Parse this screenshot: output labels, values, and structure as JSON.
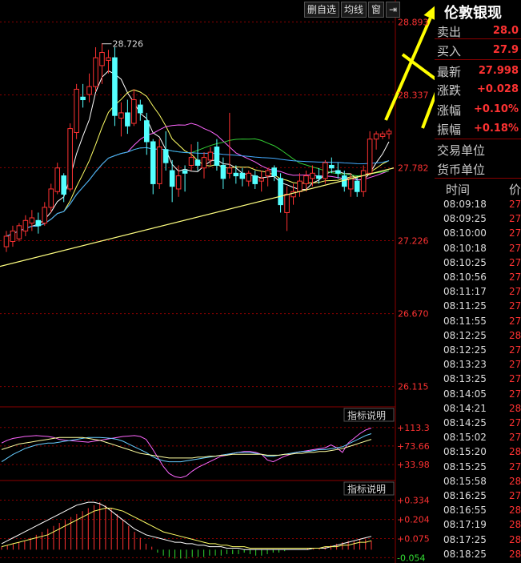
{
  "toolbar": {
    "delete_label": "删自选",
    "ma_label": "均线",
    "window_label": "窗",
    "collapse_label": "⇥"
  },
  "quote": {
    "title": "伦敦银现",
    "rows": [
      {
        "label": "卖出",
        "value": "28.0"
      },
      {
        "label": "买入",
        "value": "27.9"
      },
      {
        "label": "最新",
        "value": "27.998"
      },
      {
        "label": "涨跌",
        "value": "+0.028"
      },
      {
        "label": "涨幅",
        "value": "+0.10%"
      },
      {
        "label": "振幅",
        "value": "+0.18%"
      },
      {
        "label": "交易单位",
        "value": ""
      },
      {
        "label": "货币单位",
        "value": ""
      }
    ],
    "colors": {
      "up": "#ff3232",
      "down": "#54ffff",
      "text": "#cccccc"
    },
    "ticks_header": {
      "time": "时间",
      "price": "价"
    },
    "ticks": [
      {
        "time": "08:09:18",
        "price": "27."
      },
      {
        "time": "08:09:25",
        "price": "27."
      },
      {
        "time": "08:10:00",
        "price": "27."
      },
      {
        "time": "08:10:18",
        "price": "27."
      },
      {
        "time": "08:10:25",
        "price": "27."
      },
      {
        "time": "08:10:56",
        "price": "27."
      },
      {
        "time": "08:11:17",
        "price": "27."
      },
      {
        "time": "08:11:25",
        "price": "27."
      },
      {
        "time": "08:11:55",
        "price": "27."
      },
      {
        "time": "08:12:25",
        "price": "28."
      },
      {
        "time": "08:12:25",
        "price": "27."
      },
      {
        "time": "08:13:23",
        "price": "27."
      },
      {
        "time": "08:13:25",
        "price": "27."
      },
      {
        "time": "08:14:05",
        "price": "27."
      },
      {
        "time": "08:14:21",
        "price": "28."
      },
      {
        "time": "08:14:25",
        "price": "27."
      },
      {
        "time": "08:15:02",
        "price": "27."
      },
      {
        "time": "08:15:20",
        "price": "28."
      },
      {
        "time": "08:15:25",
        "price": "27."
      },
      {
        "time": "08:15:58",
        "price": "28."
      },
      {
        "time": "08:16:25",
        "price": "27."
      },
      {
        "time": "08:16:55",
        "price": "28."
      },
      {
        "time": "08:17:19",
        "price": "28."
      },
      {
        "time": "08:17:25",
        "price": "28."
      },
      {
        "time": "08:18:25",
        "price": "28."
      }
    ]
  },
  "chart_data": [
    {
      "type": "candlestick",
      "axis_labels": [
        "28.893",
        "28.337",
        "27.782",
        "27.226",
        "26.670",
        "26.115"
      ],
      "ylim": [
        25.96,
        28.95
      ],
      "annotation": "28.726",
      "annotation_value": 28.726,
      "colors": {
        "up": "#ff3232",
        "down": "#54ffff",
        "trendline": "#ffff80",
        "arrow": "#ffff00"
      },
      "candles": [
        [
          27.18,
          27.3,
          27.14,
          27.26
        ],
        [
          27.22,
          27.34,
          27.18,
          27.3
        ],
        [
          27.24,
          27.36,
          27.22,
          27.34
        ],
        [
          27.3,
          27.42,
          27.26,
          27.38
        ],
        [
          27.36,
          27.46,
          27.3,
          27.4
        ],
        [
          27.38,
          27.44,
          27.28,
          27.34
        ],
        [
          27.36,
          27.52,
          27.34,
          27.48
        ],
        [
          27.48,
          27.66,
          27.44,
          27.62
        ],
        [
          27.6,
          27.82,
          27.58,
          27.78
        ],
        [
          27.72,
          27.74,
          27.52,
          27.58
        ],
        [
          27.62,
          28.12,
          27.6,
          28.08
        ],
        [
          28.05,
          28.42,
          28.0,
          28.38
        ],
        [
          28.32,
          28.42,
          28.24,
          28.3
        ],
        [
          28.34,
          28.5,
          28.28,
          28.4
        ],
        [
          28.4,
          28.7,
          28.36,
          28.62
        ],
        [
          28.56,
          28.73,
          28.42,
          28.66
        ],
        [
          28.6,
          28.68,
          28.5,
          28.62
        ],
        [
          28.62,
          28.7,
          28.1,
          28.18
        ],
        [
          28.16,
          28.28,
          28.02,
          28.2
        ],
        [
          28.2,
          28.3,
          28.04,
          28.1
        ],
        [
          28.12,
          28.38,
          28.1,
          28.3
        ],
        [
          28.26,
          28.3,
          28.14,
          28.2
        ],
        [
          28.14,
          28.2,
          27.88,
          27.98
        ],
        [
          27.98,
          28.0,
          27.58,
          27.66
        ],
        [
          27.66,
          28.0,
          27.62,
          27.94
        ],
        [
          27.92,
          28.06,
          27.76,
          27.82
        ],
        [
          27.76,
          27.84,
          27.52,
          27.64
        ],
        [
          27.62,
          27.8,
          27.56,
          27.72
        ],
        [
          27.76,
          27.8,
          27.6,
          27.74
        ],
        [
          27.8,
          27.96,
          27.76,
          27.86
        ],
        [
          27.84,
          27.98,
          27.76,
          27.8
        ],
        [
          27.78,
          27.9,
          27.7,
          27.86
        ],
        [
          27.84,
          27.94,
          27.8,
          27.9
        ],
        [
          27.94,
          28.0,
          27.76,
          27.8
        ],
        [
          27.8,
          27.86,
          27.62,
          27.7
        ],
        [
          27.74,
          28.2,
          27.7,
          27.78
        ],
        [
          27.74,
          27.8,
          27.66,
          27.72
        ],
        [
          27.74,
          27.78,
          27.64,
          27.7
        ],
        [
          27.68,
          27.76,
          27.64,
          27.74
        ],
        [
          27.72,
          27.76,
          27.62,
          27.66
        ],
        [
          27.68,
          27.76,
          27.6,
          27.7
        ],
        [
          27.72,
          27.78,
          27.64,
          27.76
        ],
        [
          27.78,
          27.8,
          27.68,
          27.72
        ],
        [
          27.7,
          27.74,
          27.44,
          27.5
        ],
        [
          27.44,
          27.64,
          27.3,
          27.58
        ],
        [
          27.56,
          27.66,
          27.5,
          27.6
        ],
        [
          27.6,
          27.74,
          27.56,
          27.68
        ],
        [
          27.66,
          27.76,
          27.6,
          27.72
        ],
        [
          27.7,
          27.8,
          27.64,
          27.74
        ],
        [
          27.72,
          27.78,
          27.66,
          27.7
        ],
        [
          27.7,
          27.84,
          27.66,
          27.82
        ],
        [
          27.8,
          27.86,
          27.74,
          27.78
        ],
        [
          27.76,
          27.82,
          27.7,
          27.74
        ],
        [
          27.72,
          27.76,
          27.6,
          27.64
        ],
        [
          27.62,
          27.74,
          27.56,
          27.7
        ],
        [
          27.68,
          27.72,
          27.56,
          27.6
        ],
        [
          27.6,
          27.8,
          27.56,
          27.76
        ],
        [
          27.74,
          28.06,
          27.72,
          28.0
        ],
        [
          28.0,
          28.06,
          27.92,
          28.04
        ],
        [
          28.02,
          28.06,
          28.0,
          28.04
        ],
        [
          28.04,
          28.08,
          28.0,
          28.06
        ]
      ]
    },
    {
      "type": "line",
      "name": "indicator_1",
      "header_label": "指标说明",
      "axis_labels": [
        "+113.3",
        "+73.66",
        "+33.98"
      ],
      "axis_values": [
        113.3,
        73.66,
        33.98
      ],
      "ylim": [
        0,
        130
      ],
      "series": [
        {
          "values": [
            80,
            86,
            90,
            92,
            94,
            95,
            96,
            95,
            94,
            92,
            88,
            86,
            85,
            84,
            83,
            82,
            84,
            86,
            88,
            90,
            92,
            94,
            95,
            96,
            94,
            88,
            70,
            50,
            30,
            15,
            8,
            6,
            10,
            20,
            28,
            34,
            40,
            46,
            52,
            54,
            58,
            60,
            62,
            62,
            60,
            56,
            44,
            40,
            46,
            52,
            56,
            60,
            62,
            64,
            66,
            68,
            70,
            76,
            70,
            60,
            80,
            90,
            100,
            108,
            112
          ],
          "color": "#ff66ff"
        },
        {
          "values": [
            40,
            48,
            56,
            62,
            68,
            72,
            76,
            78,
            80,
            80,
            82,
            84,
            86,
            88,
            90,
            92,
            92,
            92,
            91,
            90,
            88,
            84,
            78,
            72,
            66,
            60,
            52,
            46,
            42,
            40,
            40,
            40,
            42,
            44,
            46,
            48,
            50,
            52,
            54,
            56,
            58,
            60,
            60,
            60,
            58,
            56,
            52,
            52,
            54,
            56,
            58,
            60,
            62,
            62,
            64,
            66,
            66,
            68,
            70,
            72,
            78,
            84,
            90,
            96,
            100
          ],
          "color": "#66ccff"
        },
        {
          "values": [
            66,
            70,
            74,
            78,
            80,
            82,
            84,
            86,
            88,
            90,
            92,
            92,
            92,
            92,
            92,
            90,
            88,
            86,
            82,
            78,
            74,
            70,
            66,
            62,
            58,
            56,
            54,
            52,
            50,
            48,
            48,
            48,
            48,
            48,
            50,
            50,
            52,
            52,
            54,
            54,
            56,
            56,
            56,
            56,
            56,
            56,
            54,
            54,
            54,
            56,
            56,
            58,
            58,
            60,
            60,
            62,
            62,
            64,
            66,
            68,
            72,
            76,
            80,
            84,
            88
          ],
          "color": "#ffffa0"
        }
      ]
    },
    {
      "type": "bar+line",
      "name": "indicator_2",
      "header_label": "指标说明",
      "axis_labels": [
        "+0.334",
        "+0.204",
        "+0.075",
        "-0.054"
      ],
      "axis_values": [
        0.334,
        0.204,
        0.075,
        -0.054
      ],
      "ylim": [
        -0.09,
        0.38
      ],
      "bars": [
        0.02,
        0.03,
        0.04,
        0.05,
        0.06,
        0.08,
        0.1,
        0.12,
        0.14,
        0.16,
        0.18,
        0.2,
        0.22,
        0.24,
        0.26,
        0.28,
        0.3,
        0.32,
        0.3,
        0.28,
        0.24,
        0.2,
        0.16,
        0.12,
        0.08,
        0.04,
        0.02,
        -0.02,
        -0.04,
        -0.05,
        -0.06,
        -0.06,
        -0.06,
        -0.05,
        -0.05,
        -0.05,
        -0.04,
        -0.04,
        -0.04,
        -0.03,
        -0.03,
        -0.03,
        -0.02,
        -0.03,
        -0.04,
        -0.04,
        -0.03,
        -0.02,
        -0.02,
        -0.01,
        0.0,
        0.0,
        0.0,
        0.01,
        0.01,
        0.01,
        0.02,
        0.03,
        0.04,
        0.05,
        0.06,
        0.06,
        0.07,
        0.07,
        0.06
      ],
      "series": [
        {
          "values": [
            0.04,
            0.06,
            0.08,
            0.1,
            0.12,
            0.14,
            0.16,
            0.18,
            0.2,
            0.22,
            0.24,
            0.26,
            0.28,
            0.3,
            0.31,
            0.32,
            0.32,
            0.31,
            0.29,
            0.26,
            0.23,
            0.2,
            0.17,
            0.14,
            0.12,
            0.1,
            0.09,
            0.08,
            0.07,
            0.06,
            0.05,
            0.05,
            0.04,
            0.04,
            0.03,
            0.03,
            0.02,
            0.02,
            0.02,
            0.01,
            0.01,
            0.01,
            0.0,
            0.0,
            0.0,
            0.0,
            0.0,
            0.0,
            0.0,
            0.0,
            0.0,
            0.0,
            0.0,
            0.0,
            0.01,
            0.01,
            0.01,
            0.02,
            0.03,
            0.04,
            0.05,
            0.06,
            0.07,
            0.08,
            0.09
          ],
          "color": "#ffffff"
        },
        {
          "values": [
            0.02,
            0.03,
            0.04,
            0.05,
            0.06,
            0.07,
            0.08,
            0.09,
            0.1,
            0.12,
            0.14,
            0.16,
            0.18,
            0.2,
            0.22,
            0.24,
            0.26,
            0.27,
            0.28,
            0.28,
            0.27,
            0.26,
            0.24,
            0.22,
            0.2,
            0.18,
            0.16,
            0.14,
            0.12,
            0.11,
            0.1,
            0.09,
            0.08,
            0.07,
            0.06,
            0.05,
            0.04,
            0.04,
            0.03,
            0.03,
            0.02,
            0.02,
            0.02,
            0.01,
            0.01,
            0.01,
            0.01,
            0.01,
            0.01,
            0.01,
            0.01,
            0.01,
            0.01,
            0.01,
            0.01,
            0.01,
            0.02,
            0.02,
            0.02,
            0.03,
            0.03,
            0.04,
            0.05,
            0.05,
            0.06
          ],
          "color": "#ffff66"
        }
      ]
    }
  ]
}
